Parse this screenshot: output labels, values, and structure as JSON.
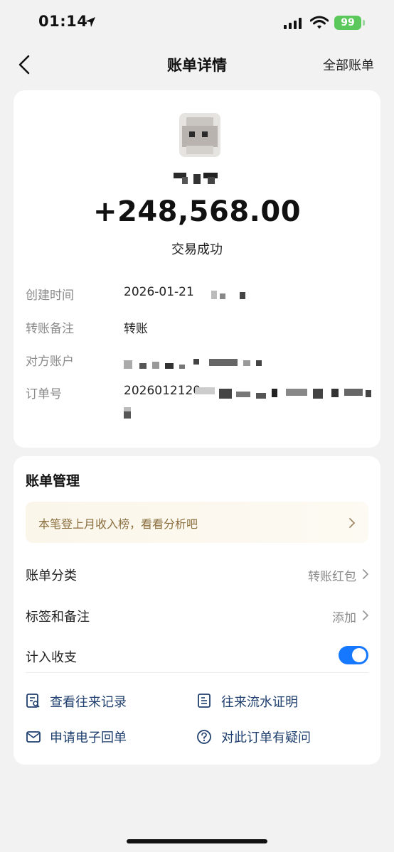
{
  "status_bar": {
    "time": "01:14",
    "battery": "99"
  },
  "nav": {
    "title": "账单详情",
    "right_link": "全部账单"
  },
  "detail": {
    "amount": "+248,568.00",
    "status": "交易成功",
    "rows": [
      {
        "label": "创建时间",
        "value": "2026-01-21"
      },
      {
        "label": "转账备注",
        "value": "转账"
      },
      {
        "label": "对方账户",
        "value": ""
      },
      {
        "label": "订单号",
        "value": "2026012120"
      }
    ]
  },
  "manage": {
    "title": "账单管理",
    "banner": "本笔登上月收入榜，看看分析吧",
    "rows": [
      {
        "label": "账单分类",
        "value": "转账红包"
      },
      {
        "label": "标签和备注",
        "value": "添加"
      },
      {
        "label": "计入收支",
        "value": ""
      }
    ],
    "toggle_on": true,
    "links": [
      "查看往来记录",
      "往来流水证明",
      "申请电子回单",
      "对此订单有疑问"
    ]
  },
  "colors": {
    "accent": "#1677ff",
    "banner_text": "#8a6e3e",
    "link_text": "#1f3f6e"
  }
}
